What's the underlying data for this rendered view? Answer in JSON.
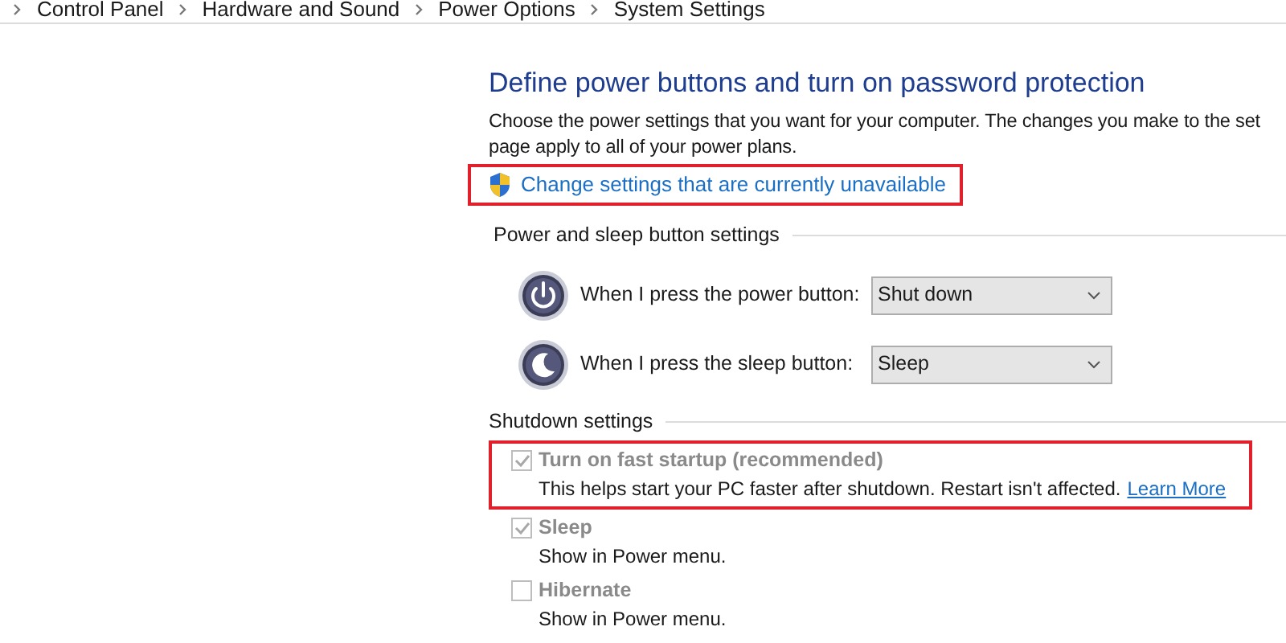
{
  "breadcrumb": [
    "Control Panel",
    "Hardware and Sound",
    "Power Options",
    "System Settings"
  ],
  "heading": "Define power buttons and turn on password protection",
  "description": [
    "Choose the power settings that you want for your computer. The changes you make to the set",
    "page apply to all of your power plans."
  ],
  "admin_link": {
    "label": "Change settings that are currently unavailable",
    "highlighted": true
  },
  "power_section": {
    "title": "Power and sleep button settings",
    "rows": [
      {
        "kind": "power",
        "label": "When I press the power button:",
        "value": "Shut down"
      },
      {
        "kind": "sleep",
        "label": "When I press the sleep button:",
        "value": "Sleep"
      }
    ]
  },
  "shutdown_section": {
    "title": "Shutdown settings",
    "options": [
      {
        "label": "Turn on fast startup (recommended)",
        "description": "This helps start your PC faster after shutdown. Restart isn't affected.",
        "link": "Learn More",
        "checked": true,
        "highlighted": true
      },
      {
        "label": "Sleep",
        "description": "Show in Power menu.",
        "checked": true,
        "highlighted": false
      },
      {
        "label": "Hibernate",
        "description": "Show in Power menu.",
        "checked": false,
        "highlighted": false
      }
    ]
  }
}
